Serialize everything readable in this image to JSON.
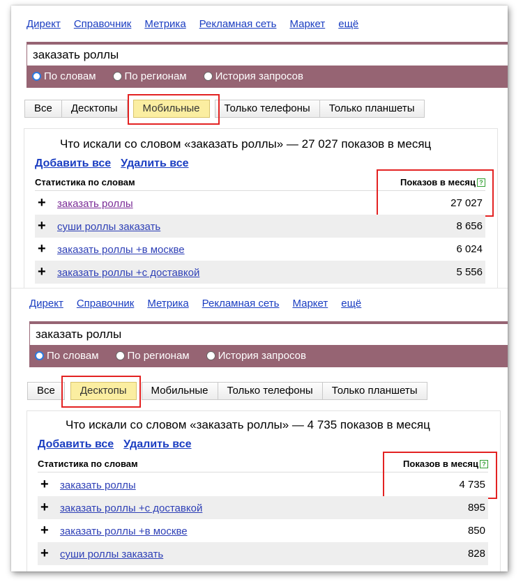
{
  "nav": [
    "Директ",
    "Справочник",
    "Метрика",
    "Рекламная сеть",
    "Маркет",
    "ещё"
  ],
  "query": "заказать роллы",
  "radios": [
    "По словам",
    "По регионам",
    "История запросов"
  ],
  "tabs": [
    "Все",
    "Десктопы",
    "Мобильные",
    "Только телефоны",
    "Только планшеты"
  ],
  "actions": {
    "add_all": "Добавить все",
    "remove_all": "Удалить все"
  },
  "table_header": {
    "left": "Статистика по словам",
    "right": "Показов в месяц",
    "help": "?"
  },
  "colors": {
    "accent": "#966473",
    "link": "#1a3dc1",
    "highlight_box": "#e32222",
    "active_tab": "#fbeea1"
  },
  "panels": [
    {
      "active_tab": "Мобильные",
      "summary": "Что искали со словом «заказать роллы» — 27 027 показов в месяц",
      "rows": [
        {
          "keyword": "заказать роллы",
          "count": "27 027"
        },
        {
          "keyword": "суши роллы заказать",
          "count": "8 656"
        },
        {
          "keyword": "заказать роллы +в москве",
          "count": "6 024"
        },
        {
          "keyword": "заказать роллы +с доставкой",
          "count": "5 556"
        }
      ]
    },
    {
      "active_tab": "Десктопы",
      "summary": "Что искали со словом «заказать роллы» — 4 735 показов в месяц",
      "rows": [
        {
          "keyword": "заказать роллы",
          "count": "4 735"
        },
        {
          "keyword": "заказать роллы +с доставкой",
          "count": "895"
        },
        {
          "keyword": "заказать роллы +в москве",
          "count": "850"
        },
        {
          "keyword": "суши роллы заказать",
          "count": "828"
        }
      ]
    }
  ]
}
